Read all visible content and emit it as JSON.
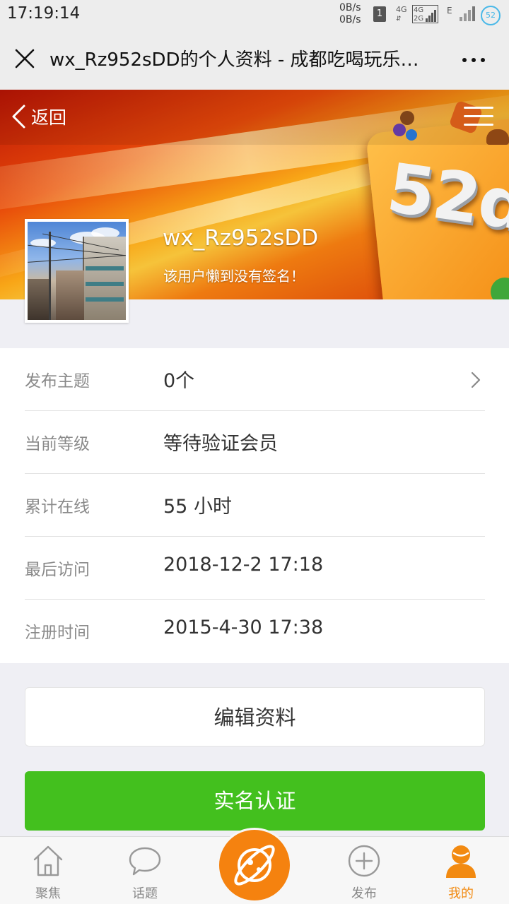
{
  "status_bar": {
    "time": "17:19:14",
    "net_up": "0B/s",
    "net_down": "0B/s",
    "sim_slot": "1",
    "signal1_label": "4G",
    "signal2_label_top": "4G",
    "signal2_label_bottom": "2G",
    "network_type": "E",
    "battery": "52"
  },
  "titlebar": {
    "title": "wx_Rz952sDD的个人资料 - 成都吃喝玩乐…",
    "close_icon": "close-icon",
    "more_icon": "more-dots-icon"
  },
  "banner": {
    "back_label": "返回",
    "brand_text": "52d",
    "username": "wx_Rz952sDD",
    "signature": "该用户懒到没有签名！"
  },
  "profile": {
    "rows": [
      {
        "label": "发布主题",
        "value": "0个"
      },
      {
        "label": "当前等级",
        "value": "等待验证会员"
      },
      {
        "label": "累计在线",
        "value": "55 小时"
      },
      {
        "label": "最后访问",
        "value": "2018-12-2 17:18"
      },
      {
        "label": "注册时间",
        "value": "2015-4-30 17:38"
      }
    ]
  },
  "actions": {
    "edit_label": "编辑资料",
    "verify_label": "实名认证"
  },
  "tabbar": {
    "items": [
      {
        "label": "聚焦",
        "icon": "home-icon"
      },
      {
        "label": "话题",
        "icon": "chat-bubble-icon"
      },
      {
        "label": "",
        "icon": "planet-icon"
      },
      {
        "label": "发布",
        "icon": "plus-circle-icon"
      },
      {
        "label": "我的",
        "icon": "user-icon"
      }
    ]
  },
  "colors": {
    "accent_orange": "#f28a11",
    "verify_green": "#43c01e"
  }
}
